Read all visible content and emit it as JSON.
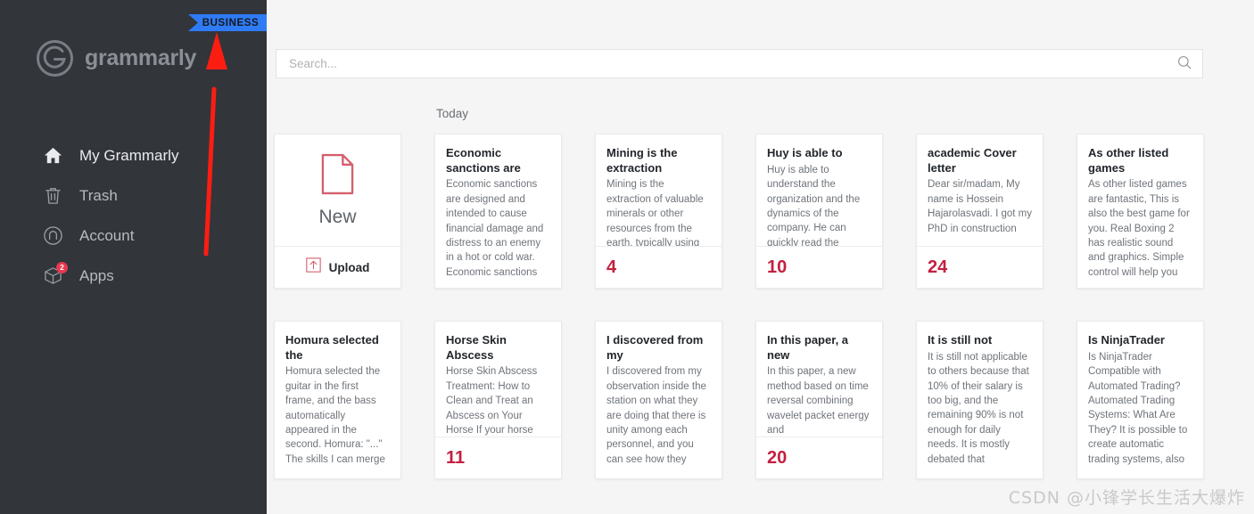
{
  "sidebar": {
    "badge": {
      "label": "BUSINESS"
    },
    "brand": {
      "name": "grammarly",
      "mark_icon": "grammarly-g-logo"
    },
    "items": [
      {
        "label": "My Grammarly",
        "icon": "home-icon",
        "active": true,
        "badge": ""
      },
      {
        "label": "Trash",
        "icon": "trash-icon",
        "active": false,
        "badge": ""
      },
      {
        "label": "Account",
        "icon": "account-icon",
        "active": false,
        "badge": ""
      },
      {
        "label": "Apps",
        "icon": "apps-cube-icon",
        "active": false,
        "badge": "2"
      }
    ],
    "annotation": {
      "type": "red-arrow",
      "points_to": "BUSINESS",
      "color": "#fc1d12"
    }
  },
  "search": {
    "placeholder": "Search...",
    "value": "",
    "icon": "search-icon"
  },
  "main": {
    "section_label": "Today",
    "new_card": {
      "new_label": "New",
      "new_icon": "new-document-icon",
      "upload_label": "Upload",
      "upload_icon": "upload-arrow-icon"
    },
    "cards": [
      {
        "title": "Economic sanctions are",
        "snippet": "Economic sanctions are designed and intended to cause financial damage and distress to an enemy in a hot or cold war. Economic sanctions",
        "count": ""
      },
      {
        "title": "Mining is the extraction",
        "snippet": "Mining is the extraction of valuable minerals or other resources from the earth, typically using",
        "count": "4"
      },
      {
        "title": "Huy is able to",
        "snippet": "Huy is able to understand the organization and the dynamics of the company. He can quickly read the",
        "count": "10"
      },
      {
        "title": "academic Cover letter",
        "snippet": "Dear sir/madam, My name is Hossein Hajarolasvadi. I got my PhD in construction",
        "count": "24"
      },
      {
        "title": "As other listed games",
        "snippet": "As other listed games are fantastic, This is also the best game for you. Real Boxing 2 has realistic sound and graphics. Simple control will help you",
        "count": ""
      }
    ],
    "cards_row2": [
      {
        "title": "Homura selected the",
        "snippet": "Homura selected the guitar in the first frame, and the bass automatically appeared in the second. Homura: \"...\" The skills I can merge",
        "count": ""
      },
      {
        "title": "Horse Skin Abscess",
        "snippet": "Horse Skin Abscess Treatment: How to Clean and Treat an Abscess on Your Horse If your horse",
        "count": "11"
      },
      {
        "title": "I discovered from my",
        "snippet": "I discovered from my observation inside the station on what they are doing that there is unity among each personnel, and you can see how they",
        "count": ""
      },
      {
        "title": "In this paper, a new",
        "snippet": "In this paper, a new method based on time reversal combining wavelet packet energy and",
        "count": "20"
      },
      {
        "title": "It is still not",
        "snippet": "It is still not applicable to others because that 10% of their salary is too big, and the remaining 90% is not enough for daily needs. It is mostly debated that",
        "count": ""
      },
      {
        "title": "Is NinjaTrader",
        "snippet": "Is NinjaTrader Compatible with Automated Trading? Automated Trading Systems: What Are They? It is possible to create automatic trading systems, also",
        "count": ""
      }
    ]
  },
  "watermark": {
    "text": "CSDN @小锋学长生活大爆炸"
  },
  "colors": {
    "sidebar_bg": "#32353a",
    "page_bg": "#f5f5f5",
    "badge_blue": "#2f7bf6",
    "count_red": "#c3203f",
    "accent_red": "#d4606c",
    "annotation_red": "#fc1d12"
  }
}
